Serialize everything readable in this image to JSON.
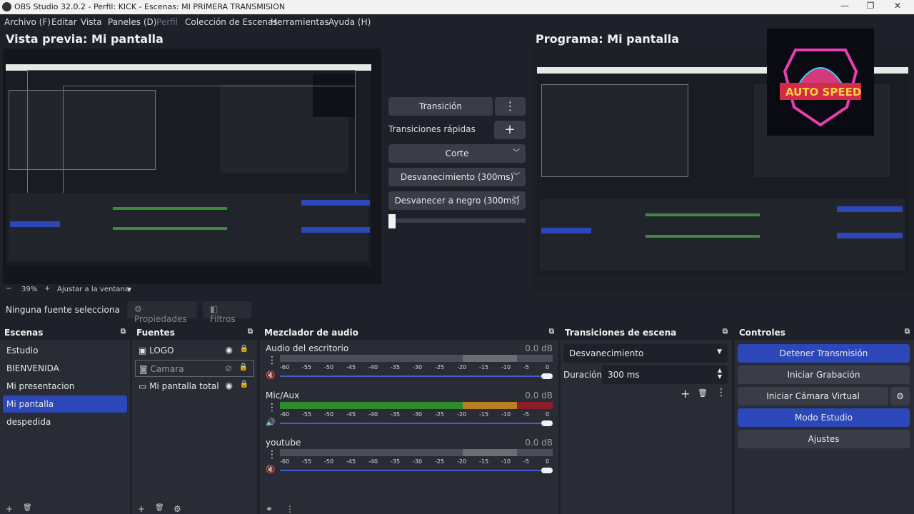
{
  "window": {
    "title": "OBS Studio 32.0.2 - Perfil: KICK - Escenas: MI PRIMERA TRANSMISION",
    "minimize": "—",
    "maximize": "❐",
    "close": "✕"
  },
  "menu": [
    "Archivo (F)",
    "Editar",
    "Vista",
    "Paneles (D)",
    "Perfil",
    "Colección de Escenas",
    "Herramientas",
    "Ayuda (H)"
  ],
  "preview": {
    "title": "Vista previa: Mi pantalla",
    "zoom_minus": "−",
    "zoom": "39%",
    "zoom_plus": "+",
    "fit": "Ajustar a la ventana",
    "fit_arrow": "▼"
  },
  "program": {
    "title": "Programa: Mi pantalla",
    "logo_text": "AUTO SPEED"
  },
  "transition": {
    "button": "Transición",
    "menu_icon": "⋮",
    "quick_label": "Transiciones rápidas",
    "add_icon": "+",
    "quick": [
      "Corte",
      "Desvanecimiento (300ms)",
      "Desvanecer a negro (300ms)"
    ]
  },
  "context": {
    "no_source": "Ninguna fuente selecciona",
    "properties": "Propiedades",
    "filters": "Filtros"
  },
  "scenes": {
    "title": "Escenas",
    "items": [
      "Estudio",
      "BIENVENIDA",
      "Mi presentacion",
      "Mi pantalla",
      "despedida"
    ]
  },
  "sources": {
    "title": "Fuentes",
    "items": [
      "LOGO",
      "Camara",
      "Mi pantalla total"
    ]
  },
  "mixer": {
    "title": "Mezclador de audio",
    "channels": [
      {
        "name": "Audio del escritorio",
        "db": "0.0 dB",
        "level": 0.0
      },
      {
        "name": "Mic/Aux",
        "db": "0.0 dB",
        "level": 0.8
      },
      {
        "name": "youtube",
        "db": "0.0 dB",
        "level": 0.0
      }
    ],
    "ticks": [
      "-60",
      "-55",
      "-50",
      "-45",
      "-40",
      "-35",
      "-30",
      "-25",
      "-20",
      "-15",
      "-10",
      "-5",
      "0"
    ]
  },
  "scene_transitions": {
    "title": "Transiciones de escena",
    "selected": "Desvanecimiento",
    "duration_label": "Duración",
    "duration_value": "300 ms"
  },
  "controls": {
    "title": "Controles",
    "stop_stream": "Detener Transmisión",
    "start_rec": "Iniciar Grabación",
    "virtual_cam": "Iniciar Cámara Virtual",
    "studio_mode": "Modo Estudio",
    "settings": "Ajustes"
  },
  "icons": {
    "float": "⧉",
    "kebab": "⋮",
    "eye": "👁",
    "lock": "🔒",
    "gear": "⚙",
    "add": "+",
    "trash": "🗑"
  },
  "colors": {
    "accent": "#2c47b8",
    "bg": "#1f212a",
    "panel": "#2a2c35",
    "button": "#3a3d48"
  }
}
